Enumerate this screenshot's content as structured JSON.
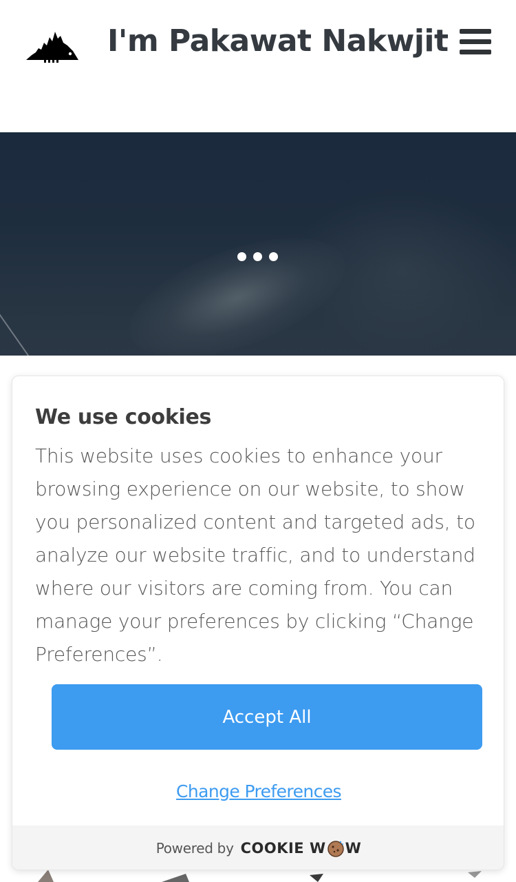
{
  "header": {
    "site_title": "I'm Pakawat Nakwjit",
    "logo_icon": "hedgehog-logo-icon",
    "menu_icon": "hamburger-menu-icon"
  },
  "hero": {
    "loading_indicator": "three-dot-loader-icon"
  },
  "cookie_banner": {
    "title": "We use cookies",
    "body": "This website uses cookies to enhance your browsing experience on our website, to show you personalized content and targeted ads, to analyze our website traffic, and to understand where our visitors are coming from. You can manage your preferences by clicking “Change Preferences”.",
    "accept_label": "Accept All",
    "change_preferences_label": "Change Preferences",
    "powered_by_label": "Powered by",
    "brand_prefix": "COOKIE W",
    "brand_suffix": "W"
  },
  "colors": {
    "accent": "#3d9bf0",
    "title_text": "#343a40",
    "hero_bg": "#1e2d3e"
  }
}
